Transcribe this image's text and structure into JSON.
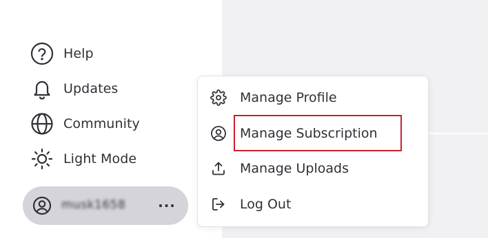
{
  "sidebar": {
    "nav": [
      {
        "label": "Help",
        "icon": "help-circle-icon"
      },
      {
        "label": "Updates",
        "icon": "bell-icon"
      },
      {
        "label": "Community",
        "icon": "globe-icon"
      },
      {
        "label": "Light Mode",
        "icon": "sun-icon"
      }
    ],
    "user": {
      "name": "musk1658",
      "more_label": "···"
    }
  },
  "menu": {
    "items": [
      {
        "label": "Manage Profile",
        "icon": "gear-icon"
      },
      {
        "label": "Manage Subscription",
        "icon": "user-circle-icon"
      },
      {
        "label": "Manage Uploads",
        "icon": "upload-icon"
      },
      {
        "label": "Log Out",
        "icon": "logout-icon"
      }
    ]
  },
  "colors": {
    "accent_highlight": "#c8202e",
    "user_pill_bg": "#d4d4da",
    "main_bg": "#f1f1f3"
  }
}
